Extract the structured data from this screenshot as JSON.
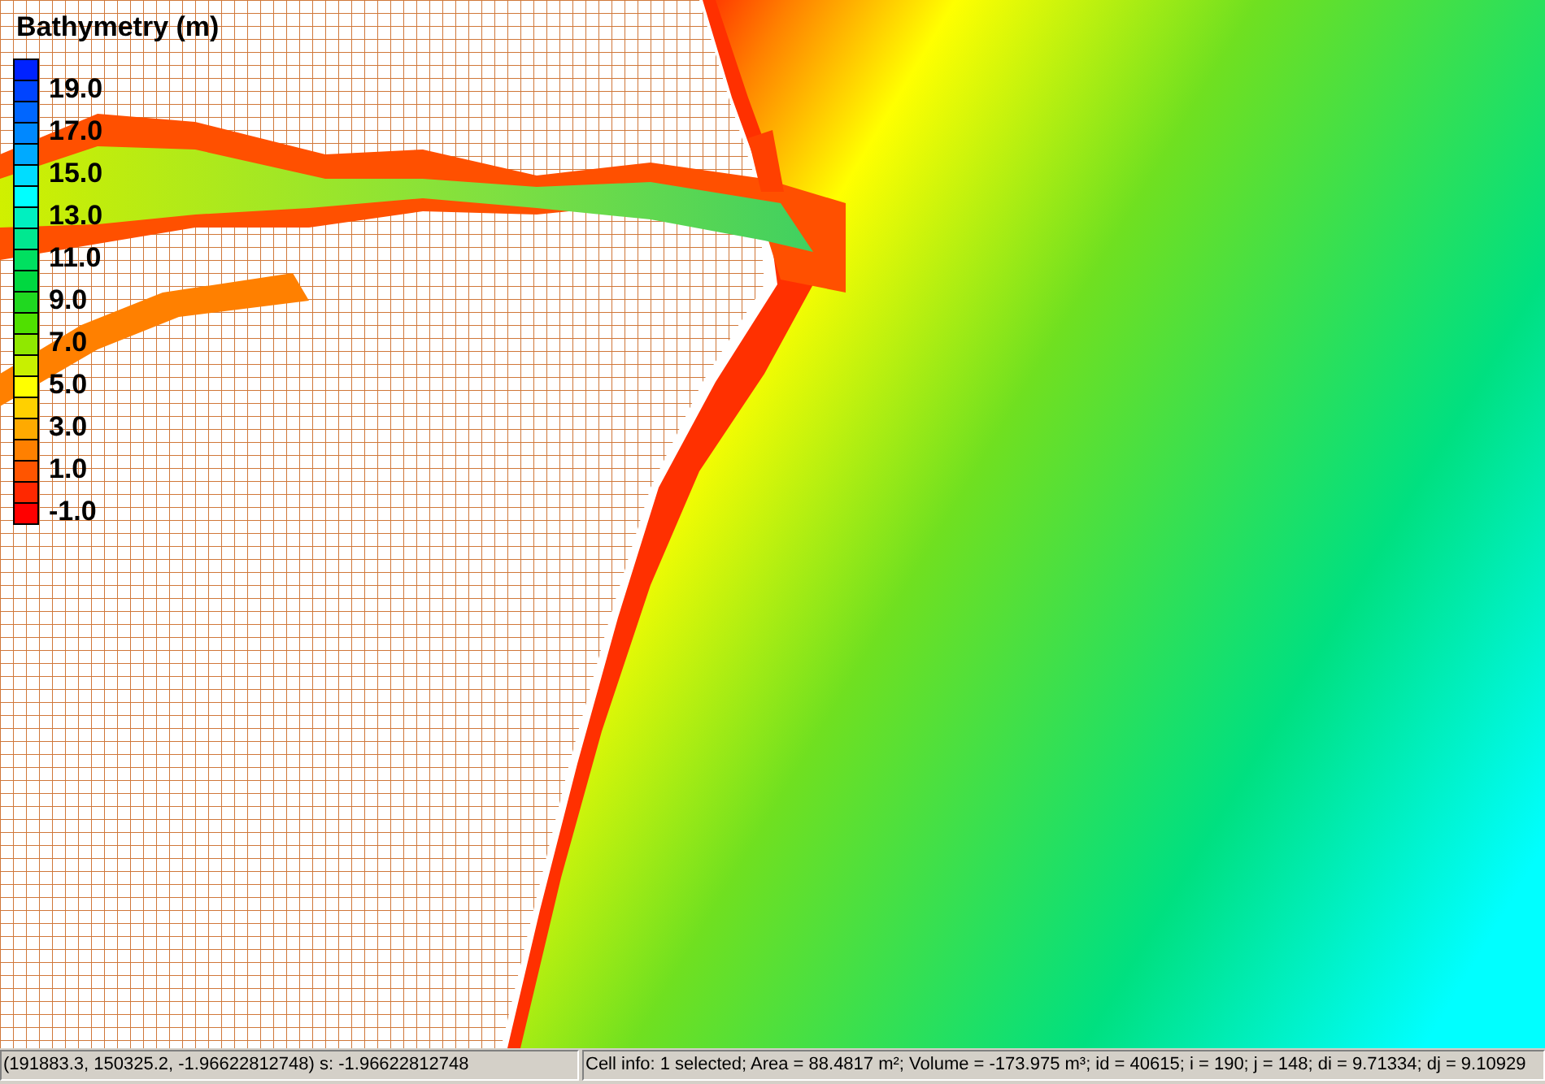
{
  "legend": {
    "title": "Bathymetry (m)",
    "labels": [
      "19.0",
      "17.0",
      "15.0",
      "13.0",
      "11.0",
      "9.0",
      "7.0",
      "5.0",
      "3.0",
      "1.0",
      "-1.0"
    ]
  },
  "status_bar": {
    "coordinates": "(191883.3, 150325.2, -1.96622812748) s: -1.96622812748",
    "cell_info": "Cell info: 1 selected; Area = 88.4817 m²; Volume = -173.975 m³; id = 40615; i = 190; j = 148; di = 9.71334; dj = 9.10929"
  }
}
